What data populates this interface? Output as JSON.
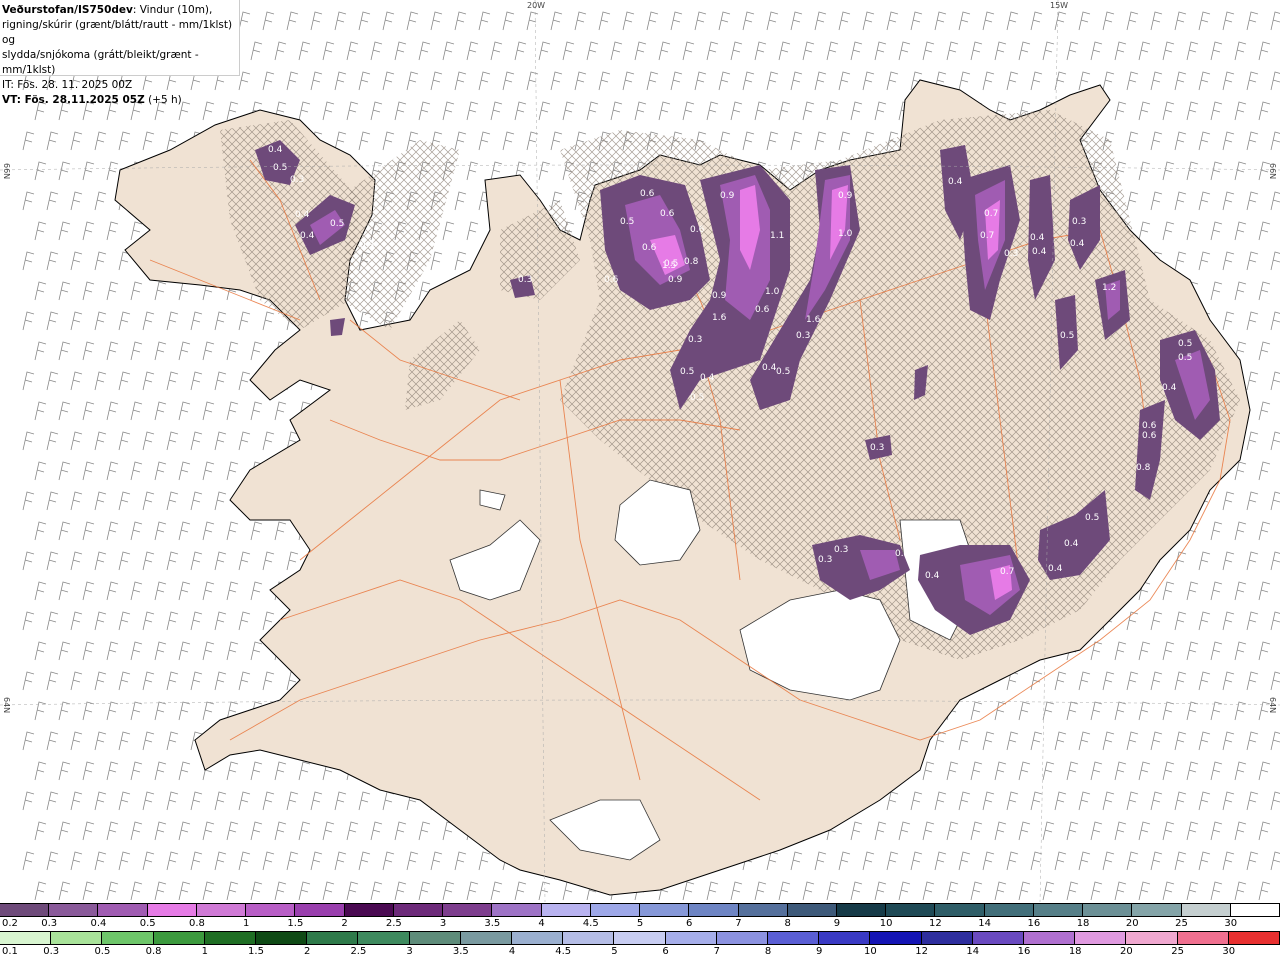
{
  "header": {
    "title_bold": "Veðurstofan/IS750dev",
    "title_rest": ": Vindur (10m),",
    "line2": "rigning/skúrir (grænt/blátt/rautt - mm/1klst) og",
    "line3": "slydda/snjókoma (grátt/bleikt/grænt - mm/1klst)",
    "init_time": "IT: Fös. 28. 11. 2025 00Z",
    "valid_time_bold": "VT: Fös. 28.11.2025 05Z",
    "valid_offset": " (+5 h)"
  },
  "graticule": {
    "top_labels": [
      "20W",
      "15W"
    ],
    "left_labels": [
      "66N",
      "64N"
    ],
    "right_labels": [
      "66N",
      "64N"
    ]
  },
  "colors": {
    "land": "#f0e2d3",
    "glacier": "#ffffff",
    "roads": "#e8743a",
    "wind_barbs": "#8a8a8a",
    "hatch": "#8a7d72",
    "precip_light": "#6e4a7a",
    "precip_mid": "#a05cb2",
    "precip_high": "#e67be6"
  },
  "precip_labels": [
    "0.4",
    "0.5",
    "0.3",
    "0.4",
    "0.5",
    "0.4",
    "0.3",
    "0.3",
    "0.6",
    "0.5",
    "0.6",
    "0.5",
    "0.6",
    "0.6",
    "1.5",
    "0.8",
    "0.9",
    "0.9",
    "1.6",
    "0.6",
    "0.3",
    "0.5",
    "0.4",
    "0.5",
    "0.9",
    "1.1",
    "1.0",
    "0.6",
    "1.6",
    "0.3",
    "0.4",
    "0.5",
    "0.9",
    "1.0",
    "0.4",
    "0.7",
    "0.7",
    "0.3",
    "0.4",
    "0.4",
    "0.3",
    "0.4",
    "1.2",
    "0.5",
    "0.5",
    "0.5",
    "0.4",
    "0.6",
    "0.6",
    "0.8",
    "0.3",
    "0.3",
    "0.3",
    "0.7",
    "0.4",
    "0.7",
    "0.4",
    "0.5",
    "0.4"
  ],
  "legend_snow": {
    "labels": [
      "0.2",
      "0.3",
      "0.4",
      "0.5",
      "0.8",
      "1",
      "1.5",
      "2",
      "2.5",
      "3",
      "3.5",
      "4",
      "4.5",
      "5",
      "6",
      "7",
      "8",
      "9",
      "10",
      "12",
      "14",
      "16",
      "18",
      "20",
      "25",
      "30"
    ],
    "colors": [
      "#6e4a7a",
      "#8a5a9a",
      "#a05cb2",
      "#e67be6",
      "#d07ad6",
      "#b85ec6",
      "#9a3fae",
      "#4a0a52",
      "#6d2a7a",
      "#7e3e8e",
      "#9e73c6",
      "#b9b3f0",
      "#9ea8e8",
      "#8698d8",
      "#6e85c4",
      "#55709c",
      "#3e5a7a",
      "#163b48",
      "#1f4a56",
      "#2f5e68",
      "#426f7a",
      "#567f88",
      "#6c9096",
      "#84a4a8",
      "#c5cfd0",
      "#ffffff"
    ]
  },
  "legend_rain": {
    "labels": [
      "0.1",
      "0.3",
      "0.5",
      "0.8",
      "1",
      "1.5",
      "2",
      "2.5",
      "3",
      "3.5",
      "4",
      "4.5",
      "5",
      "6",
      "7",
      "8",
      "9",
      "10",
      "12",
      "14",
      "16",
      "18",
      "20",
      "25",
      "30"
    ],
    "colors": [
      "#d8f5d0",
      "#a9e39a",
      "#6ec66a",
      "#3c9a3e",
      "#1f6e24",
      "#0f4a15",
      "#2e7a4a",
      "#3e8a5e",
      "#5e8c7a",
      "#7a9aa0",
      "#9bb0d0",
      "#b5bde6",
      "#c8cdf2",
      "#a6aeea",
      "#8c92e0",
      "#5a5ed4",
      "#3a3ac4",
      "#1414b4",
      "#2e2e9e",
      "#6a4ac0",
      "#b070d0",
      "#e09ae0",
      "#f0a8d0",
      "#f07090",
      "#e83030"
    ]
  }
}
